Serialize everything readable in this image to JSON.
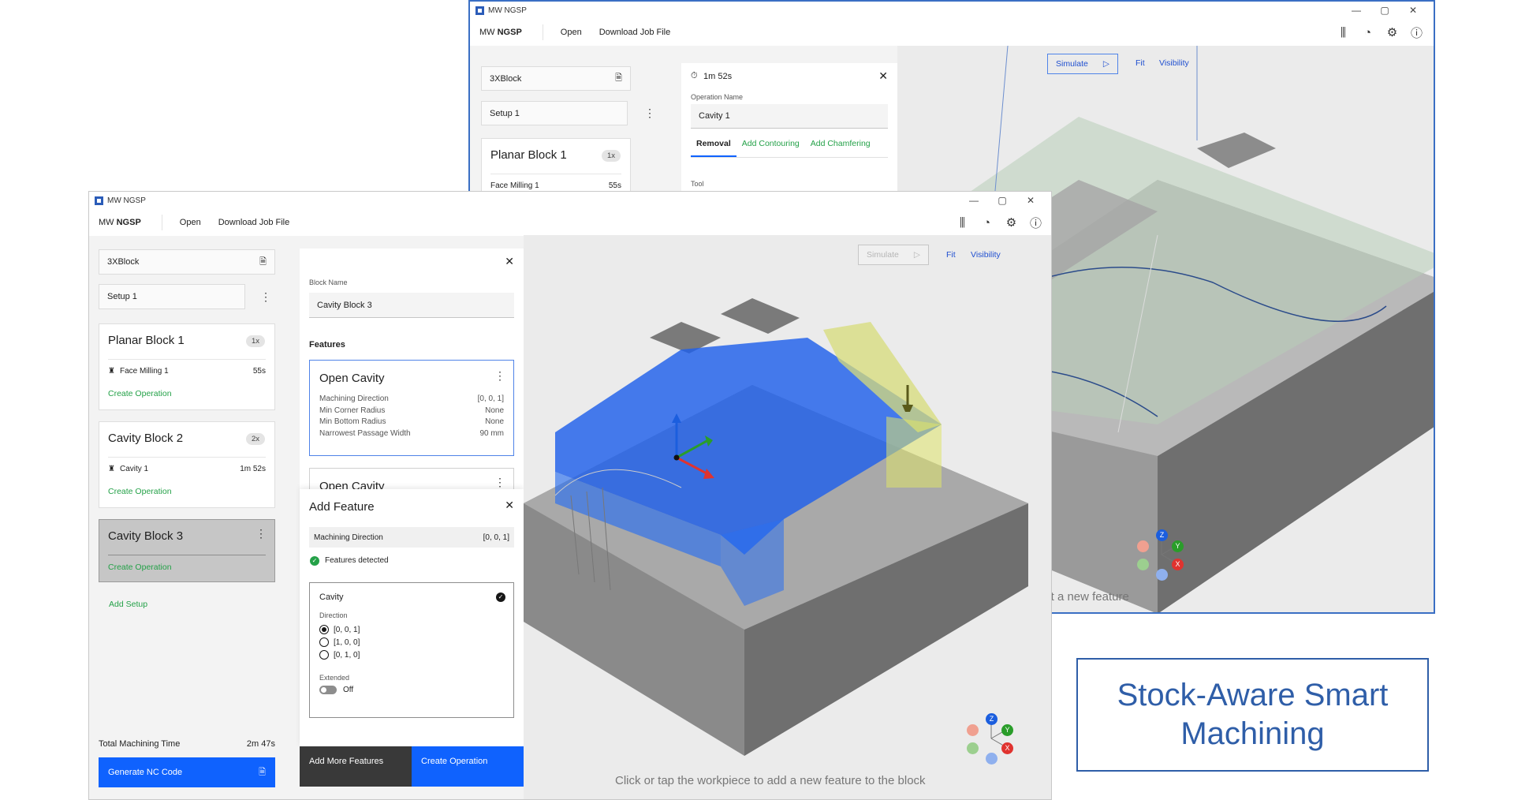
{
  "back_window": {
    "title": "MW NGSP",
    "window_controls": [
      "—",
      "▢",
      "✕"
    ],
    "brand_prefix": "MW",
    "brand_name": "NGSP",
    "menu": {
      "open": "Open",
      "download": "Download Job File"
    },
    "sidebar": {
      "block_file": "3XBlock",
      "setup": "Setup 1",
      "planar_title": "Planar Block 1",
      "planar_badge": "1x",
      "op_name": "Face Milling 1",
      "op_time": "55s"
    },
    "op_panel": {
      "time": "1m 52s",
      "name_label": "Operation Name",
      "name_value": "Cavity 1",
      "tabs": [
        "Removal",
        "Add Contouring",
        "Add Chamfering"
      ],
      "tool_label": "Tool"
    },
    "toolbar": {
      "simulate": "Simulate",
      "fit": "Fit",
      "visibility": "Visibility"
    },
    "hint": "or tap the workpiece to detect a new feature",
    "axes": {
      "z": "Z",
      "y": "Y",
      "x": "X"
    }
  },
  "front_window": {
    "title": "MW NGSP",
    "window_controls": [
      "—",
      "▢",
      "✕"
    ],
    "brand_prefix": "MW",
    "brand_name": "NGSP",
    "menu": {
      "open": "Open",
      "download": "Download Job File"
    },
    "sidebar": {
      "block_file": "3XBlock",
      "setup": "Setup 1",
      "blocks": [
        {
          "title": "Planar Block 1",
          "badge": "1x",
          "op_name": "Face Milling 1",
          "op_time": "55s",
          "create": "Create Operation"
        },
        {
          "title": "Cavity Block 2",
          "badge": "2x",
          "op_name": "Cavity 1",
          "op_time": "1m 52s",
          "create": "Create Operation"
        },
        {
          "title": "Cavity Block 3",
          "create": "Create Operation"
        }
      ],
      "add_setup": "Add Setup",
      "total_label": "Total Machining Time",
      "total_value": "2m 47s",
      "generate": "Generate NC Code"
    },
    "block_panel": {
      "name_label": "Block Name",
      "name_value": "Cavity Block 3",
      "features_heading": "Features",
      "feature1": {
        "title": "Open Cavity",
        "rows": [
          {
            "k": "Machining Direction",
            "v": "[0, 0, 1]"
          },
          {
            "k": "Min Corner Radius",
            "v": "None"
          },
          {
            "k": "Min Bottom Radius",
            "v": "None"
          },
          {
            "k": "Narrowest Passage Width",
            "v": "90 mm"
          }
        ]
      },
      "feature2_title": "Open Cavity"
    },
    "add_feature": {
      "title": "Add Feature",
      "dir_label": "Machining Direction",
      "dir_value": "[0, 0, 1]",
      "detected": "Features detected",
      "cavity": "Cavity",
      "direction_label": "Direction",
      "options": [
        "[0, 0, 1]",
        "[1, 0, 0]",
        "[0, 1, 0]"
      ],
      "extended_label": "Extended",
      "toggle_value": "Off",
      "add_more": "Add More Features",
      "create_op": "Create Operation"
    },
    "toolbar": {
      "simulate": "Simulate",
      "fit": "Fit",
      "visibility": "Visibility"
    },
    "hint": "Click or tap the workpiece to add a new feature to the block",
    "axes": {
      "z": "Z",
      "y": "Y",
      "x": "X"
    }
  },
  "tagline": "Stock-Aware Smart Machining",
  "colors": {
    "accent_blue": "#0f62fe",
    "green": "#24a148",
    "frame_blue": "#2b5cb8",
    "tagline_blue": "#2f5ea8"
  }
}
